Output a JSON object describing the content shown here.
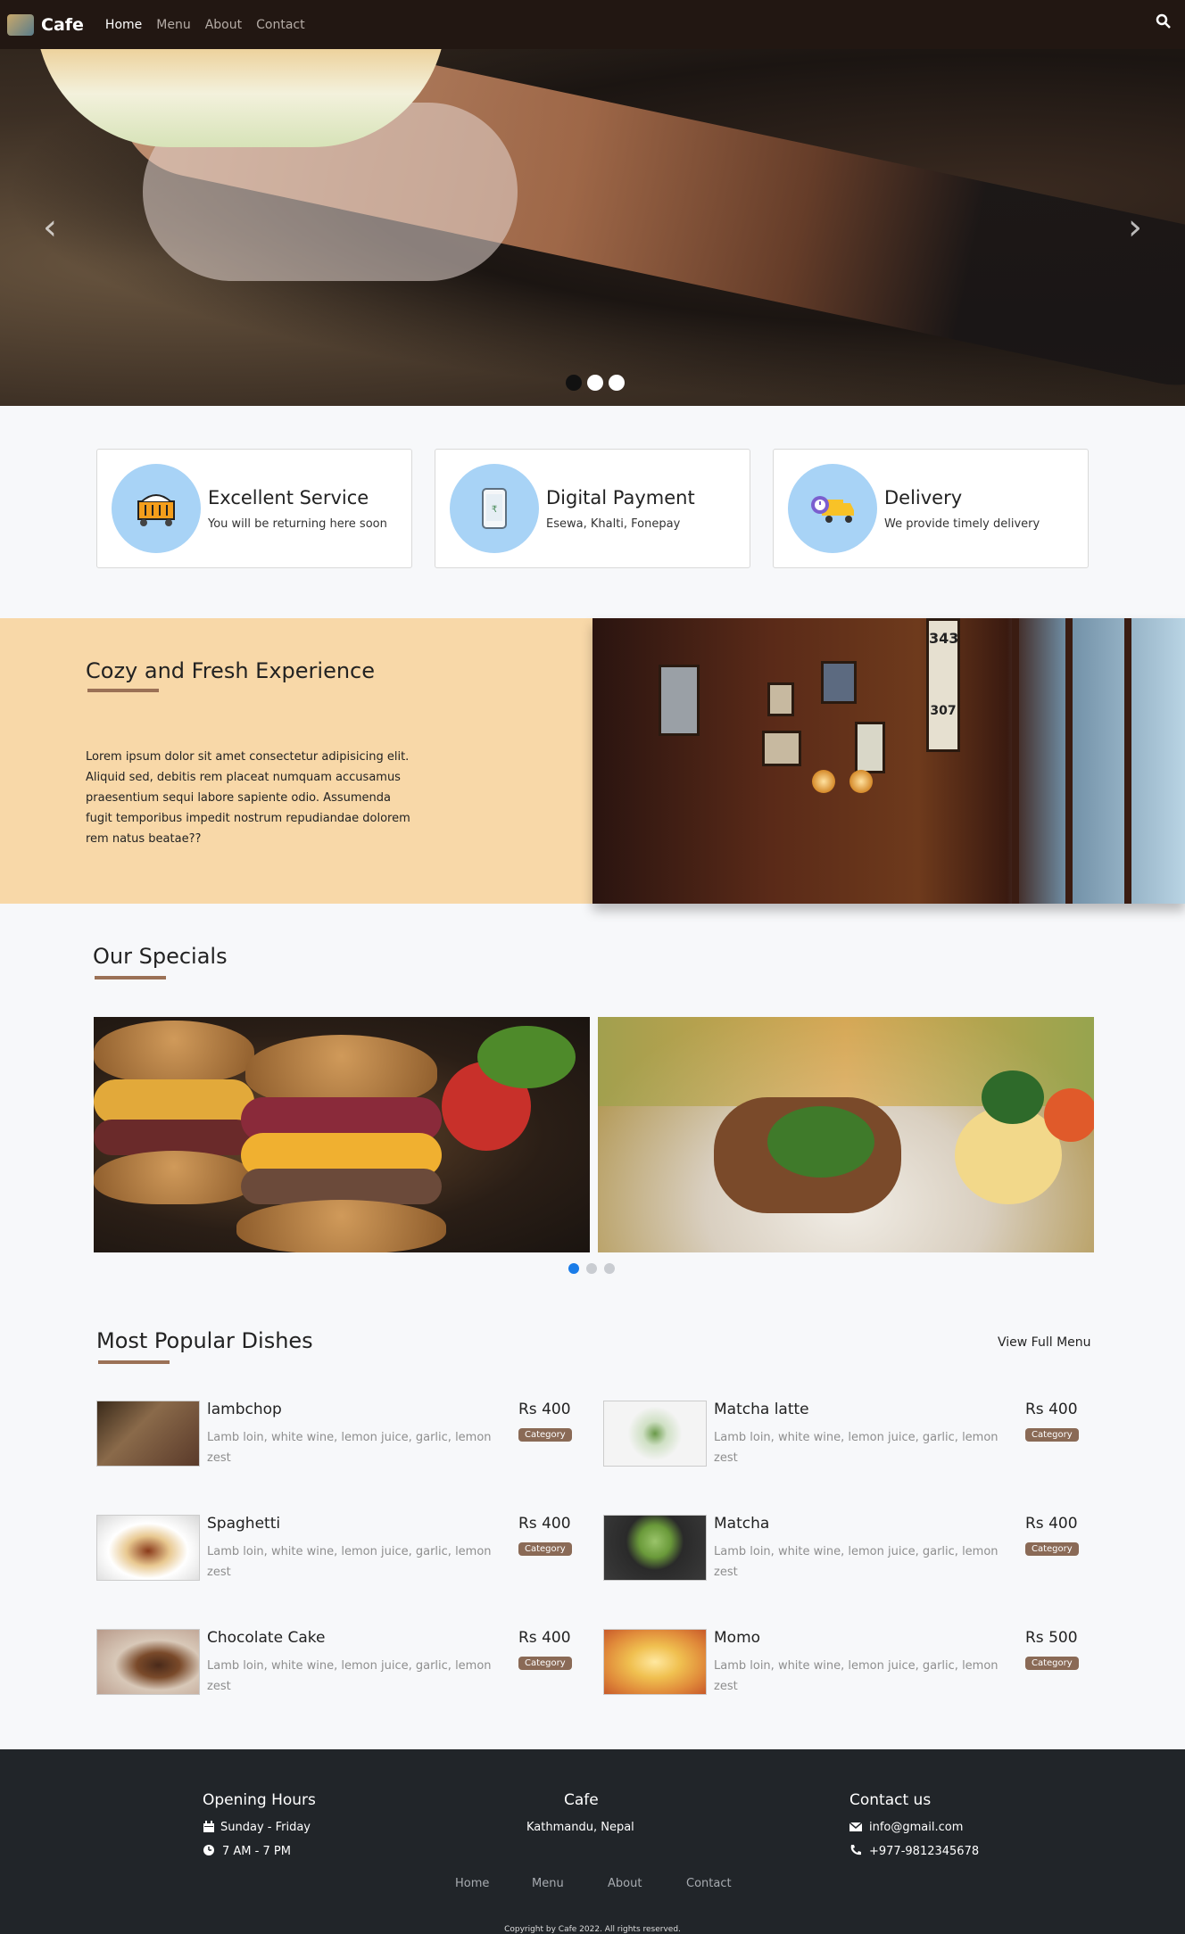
{
  "nav": {
    "brand": "Cafe",
    "links": [
      "Home",
      "Menu",
      "About",
      "Contact"
    ]
  },
  "hero": {
    "slides": 3,
    "active_slide": 1
  },
  "features": [
    {
      "title": "Excellent Service",
      "desc": "You will be returning here soon",
      "icon": "food-cart-icon"
    },
    {
      "title": "Digital Payment",
      "desc": "Esewa, Khalti, Fonepay",
      "icon": "mobile-payment-icon"
    },
    {
      "title": "Delivery",
      "desc": "We provide timely delivery",
      "icon": "delivery-truck-icon"
    }
  ],
  "cozy": {
    "title": "Cozy and Fresh Experience",
    "text": " Lorem ipsum dolor sit amet consectetur adipisicing elit. Aliquid sed, debitis rem placeat numquam accusamus praesentium sequi labore sapiente odio. Assumenda fugit temporibus impedit nostrum repudiandae dolorem rem natus beatae??",
    "image_numbers": [
      "343",
      "307"
    ]
  },
  "specials": {
    "title": "Our Specials",
    "slides": 3,
    "active_slide": 1
  },
  "popular": {
    "title": "Most Popular Dishes",
    "view_menu": "View Full Menu",
    "dishes": [
      {
        "name": "lambchop",
        "desc": "Lamb loin, white wine, lemon juice, garlic, lemon zest",
        "price": "Rs 400",
        "badge": "Category"
      },
      {
        "name": "Matcha latte",
        "desc": "Lamb loin, white wine, lemon juice, garlic, lemon zest",
        "price": "Rs 400",
        "badge": "Category"
      },
      {
        "name": "Spaghetti",
        "desc": "Lamb loin, white wine, lemon juice, garlic, lemon zest",
        "price": "Rs 400",
        "badge": "Category"
      },
      {
        "name": "Matcha",
        "desc": "Lamb loin, white wine, lemon juice, garlic, lemon zest",
        "price": "Rs 400",
        "badge": "Category"
      },
      {
        "name": "Chocolate Cake",
        "desc": "Lamb loin, white wine, lemon juice, garlic, lemon zest",
        "price": "Rs 400",
        "badge": "Category"
      },
      {
        "name": "Momo",
        "desc": "Lamb loin, white wine, lemon juice, garlic, lemon zest",
        "price": "Rs 500",
        "badge": "Category"
      }
    ]
  },
  "footer": {
    "hours_title": "Opening Hours",
    "days": "Sunday - Friday",
    "time": "7 AM - 7 PM",
    "cafe_title": "Cafe",
    "location": "Kathmandu, Nepal",
    "contact_title": "Contact us",
    "email": "info@gmail.com",
    "phone": "+977-9812345678",
    "links": [
      "Home",
      "Menu",
      "About",
      "Contact"
    ],
    "copyright": "Copyright by Cafe 2022. All rights reserved."
  },
  "colors": {
    "navbar": "#221712",
    "accent": "#9b7156",
    "cozy_bg": "#f8d8a8",
    "footer": "#212529",
    "badge": "#8a6a56",
    "carousel_active": "#1a7ce8"
  }
}
